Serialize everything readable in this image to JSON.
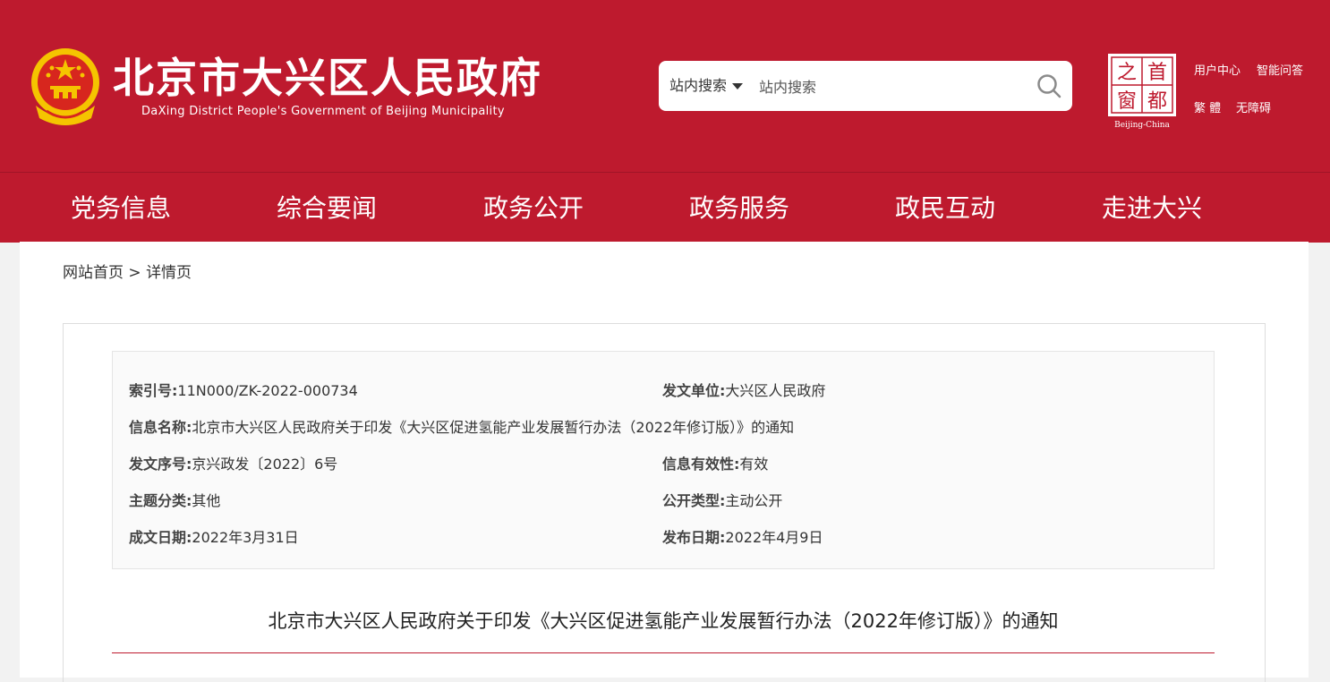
{
  "header": {
    "title": "北京市大兴区人民政府",
    "subtitle": "DaXing District People's Government of Beijing Municipality",
    "search": {
      "scope": "站内搜索",
      "placeholder": "站内搜索"
    },
    "capital_logo": {
      "chars": [
        "之",
        "首",
        "窗",
        "都"
      ],
      "caption": "Beijing-China"
    },
    "links": {
      "user_center": "用户中心",
      "smart_qa": "智能问答",
      "traditional": "繁 體",
      "accessibility": "无障碍"
    },
    "brand_color": "#be1a2e"
  },
  "nav": {
    "items": [
      "党务信息",
      "综合要闻",
      "政务公开",
      "政务服务",
      "政民互动",
      "走进大兴"
    ]
  },
  "breadcrumb": {
    "home": "网站首页",
    "separator": ">",
    "current": "详情页"
  },
  "meta": {
    "index_label": "索引号:",
    "index_value": "11N000/ZK-2022-000734",
    "issuer_label": "发文单位:",
    "issuer_value": "大兴区人民政府",
    "name_label": "信息名称:",
    "name_value": "北京市大兴区人民政府关于印发《大兴区促进氢能产业发展暂行办法（2022年修订版）》的通知",
    "doc_no_label": "发文序号:",
    "doc_no_value": "京兴政发〔2022〕6号",
    "validity_label": "信息有效性:",
    "validity_value": "有效",
    "topic_label": "主题分类:",
    "topic_value": "其他",
    "public_type_label": "公开类型:",
    "public_type_value": "主动公开",
    "written_date_label": "成文日期:",
    "written_date_value": "2022年3月31日",
    "publish_date_label": "发布日期:",
    "publish_date_value": "2022年4月9日"
  },
  "article": {
    "title": "北京市大兴区人民政府关于印发《大兴区促进氢能产业发展暂行办法（2022年修订版）》的通知"
  }
}
